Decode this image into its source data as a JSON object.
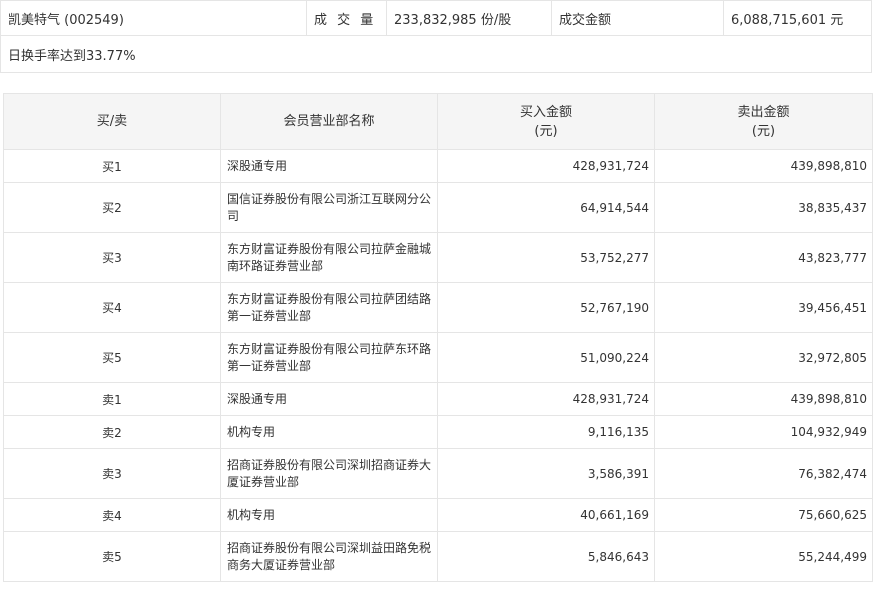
{
  "summary": {
    "stock": "凯美特气 (002549)",
    "volume_label": "成 交 量",
    "volume_value": "233,832,985 份/股",
    "amount_label": "成交金额",
    "amount_value": "6,088,715,601 元",
    "note": "日换手率达到33.77%"
  },
  "table": {
    "headers": {
      "side": "买/卖",
      "name": "会员营业部名称",
      "buy_line1": "买入金额",
      "buy_line2": "(元)",
      "sell_line1": "卖出金额",
      "sell_line2": "(元)"
    },
    "rows": [
      {
        "side": "买1",
        "name_line1": "深股通专用",
        "name_line2": "",
        "buy": "428,931,724",
        "sell": "439,898,810"
      },
      {
        "side": "买2",
        "name_line1": "国信证券股份有限公司浙江互联网分公",
        "name_line2": "司",
        "buy": "64,914,544",
        "sell": "38,835,437"
      },
      {
        "side": "买3",
        "name_line1": "东方财富证券股份有限公司拉萨金融城",
        "name_line2": "南环路证券营业部",
        "buy": "53,752,277",
        "sell": "43,823,777"
      },
      {
        "side": "买4",
        "name_line1": "东方财富证券股份有限公司拉萨团结路",
        "name_line2": "第一证券营业部",
        "buy": "52,767,190",
        "sell": "39,456,451"
      },
      {
        "side": "买5",
        "name_line1": "东方财富证券股份有限公司拉萨东环路",
        "name_line2": "第一证券营业部",
        "buy": "51,090,224",
        "sell": "32,972,805"
      },
      {
        "side": "卖1",
        "name_line1": "深股通专用",
        "name_line2": "",
        "buy": "428,931,724",
        "sell": "439,898,810"
      },
      {
        "side": "卖2",
        "name_line1": "机构专用",
        "name_line2": "",
        "buy": "9,116,135",
        "sell": "104,932,949"
      },
      {
        "side": "卖3",
        "name_line1": "招商证券股份有限公司深圳招商证券大",
        "name_line2": "厦证券营业部",
        "buy": "3,586,391",
        "sell": "76,382,474"
      },
      {
        "side": "卖4",
        "name_line1": "机构专用",
        "name_line2": "",
        "buy": "40,661,169",
        "sell": "75,660,625"
      },
      {
        "side": "卖5",
        "name_line1": "招商证券股份有限公司深圳益田路免税",
        "name_line2": "商务大厦证券营业部",
        "buy": "5,846,643",
        "sell": "55,244,499"
      }
    ]
  }
}
